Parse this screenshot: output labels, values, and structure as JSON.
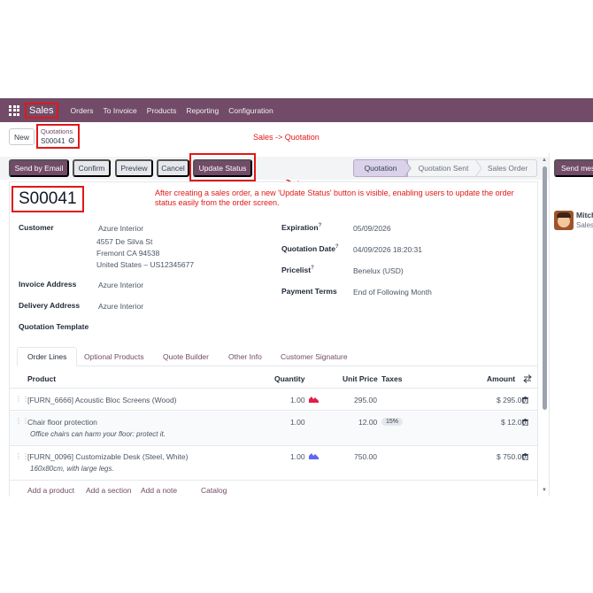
{
  "topbar": {
    "app_name": "Sales",
    "nav": [
      "Orders",
      "To Invoice",
      "Products",
      "Reporting",
      "Configuration"
    ]
  },
  "control": {
    "new_label": "New",
    "breadcrumb_parent": "Quotations",
    "breadcrumb_record": "S00041",
    "annotation": "Sales -> Quotation"
  },
  "actions": {
    "send_email": "Send by Email",
    "confirm": "Confirm",
    "preview": "Preview",
    "cancel": "Cancel",
    "update_status": "Update Status"
  },
  "status_stages": [
    "Quotation",
    "Quotation Sent",
    "Sales Order"
  ],
  "chatter": {
    "send_message": "Send mes",
    "author": "Mitch",
    "author_sub": "Sales"
  },
  "record": {
    "name": "S00041",
    "annotation": "After creating a sales order, a new 'Update Status' button is visible, enabling users to update the order status easily from the order screen."
  },
  "fields": {
    "customer_label": "Customer",
    "customer_name": "Azure Interior",
    "address_line1": "4557 De Silva St",
    "address_line2": "Fremont CA 94538",
    "address_line3": "United States – US12345677",
    "invoice_address_label": "Invoice Address",
    "invoice_address": "Azure Interior",
    "delivery_address_label": "Delivery Address",
    "delivery_address": "Azure Interior",
    "template_label": "Quotation Template",
    "expiration_label": "Expiration",
    "expiration": "05/09/2026",
    "quotation_date_label": "Quotation Date",
    "quotation_date": "04/09/2026 18:20:31",
    "pricelist_label": "Pricelist",
    "pricelist": "Benelux (USD)",
    "payment_terms_label": "Payment Terms",
    "payment_terms": "End of Following Month",
    "help_mark": "?"
  },
  "tabs": [
    "Order Lines",
    "Optional Products",
    "Quote Builder",
    "Other Info",
    "Customer Signature"
  ],
  "table": {
    "headers": [
      "Product",
      "Quantity",
      "Unit Price",
      "Taxes",
      "Amount"
    ],
    "rows": [
      {
        "product": "[FURN_6666] Acoustic Bloc Screens (Wood)",
        "note": "",
        "qty": "1.00",
        "price": "295.00",
        "tax": "",
        "amount": "$ 295.00"
      },
      {
        "product": "Chair floor protection",
        "note": "Office chairs can harm your floor: protect it.",
        "qty": "1.00",
        "price": "12.00",
        "tax": "15%",
        "amount": "$ 12.00"
      },
      {
        "product": "[FURN_0096] Customizable Desk (Steel, White)",
        "note": "160x80cm, with large legs.",
        "qty": "1.00",
        "price": "750.00",
        "tax": "",
        "amount": "$ 750.00"
      }
    ]
  },
  "footer_links": [
    "Add a product",
    "Add a section",
    "Add a note",
    "Catalog"
  ],
  "colors": {
    "brand": "#714b67",
    "annotation": "#e01818",
    "forecast_red": "#e11d48",
    "forecast_purple": "#6366f1"
  }
}
